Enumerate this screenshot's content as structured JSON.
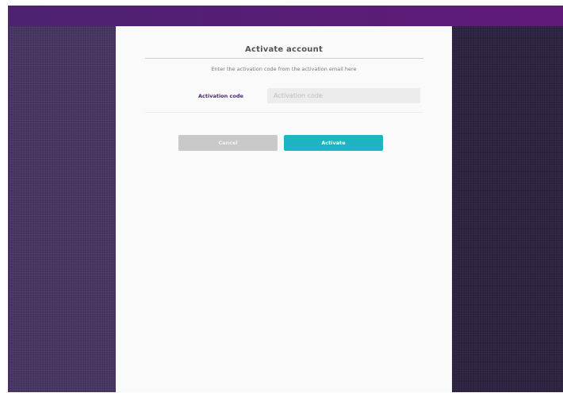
{
  "dialog": {
    "title": "Activate account",
    "instructions": "Enter the activation code from the activation email here"
  },
  "form": {
    "activation_code": {
      "label": "Activation code",
      "value": "",
      "placeholder": "Activation code"
    }
  },
  "actions": {
    "cancel_label": "Cancel",
    "activate_label": "Activate"
  },
  "colors": {
    "accent": "#1db3c2",
    "brand_purple": "#4a2670",
    "topbar": "#5a1d78",
    "cancel_gray": "#c9c9c9"
  }
}
